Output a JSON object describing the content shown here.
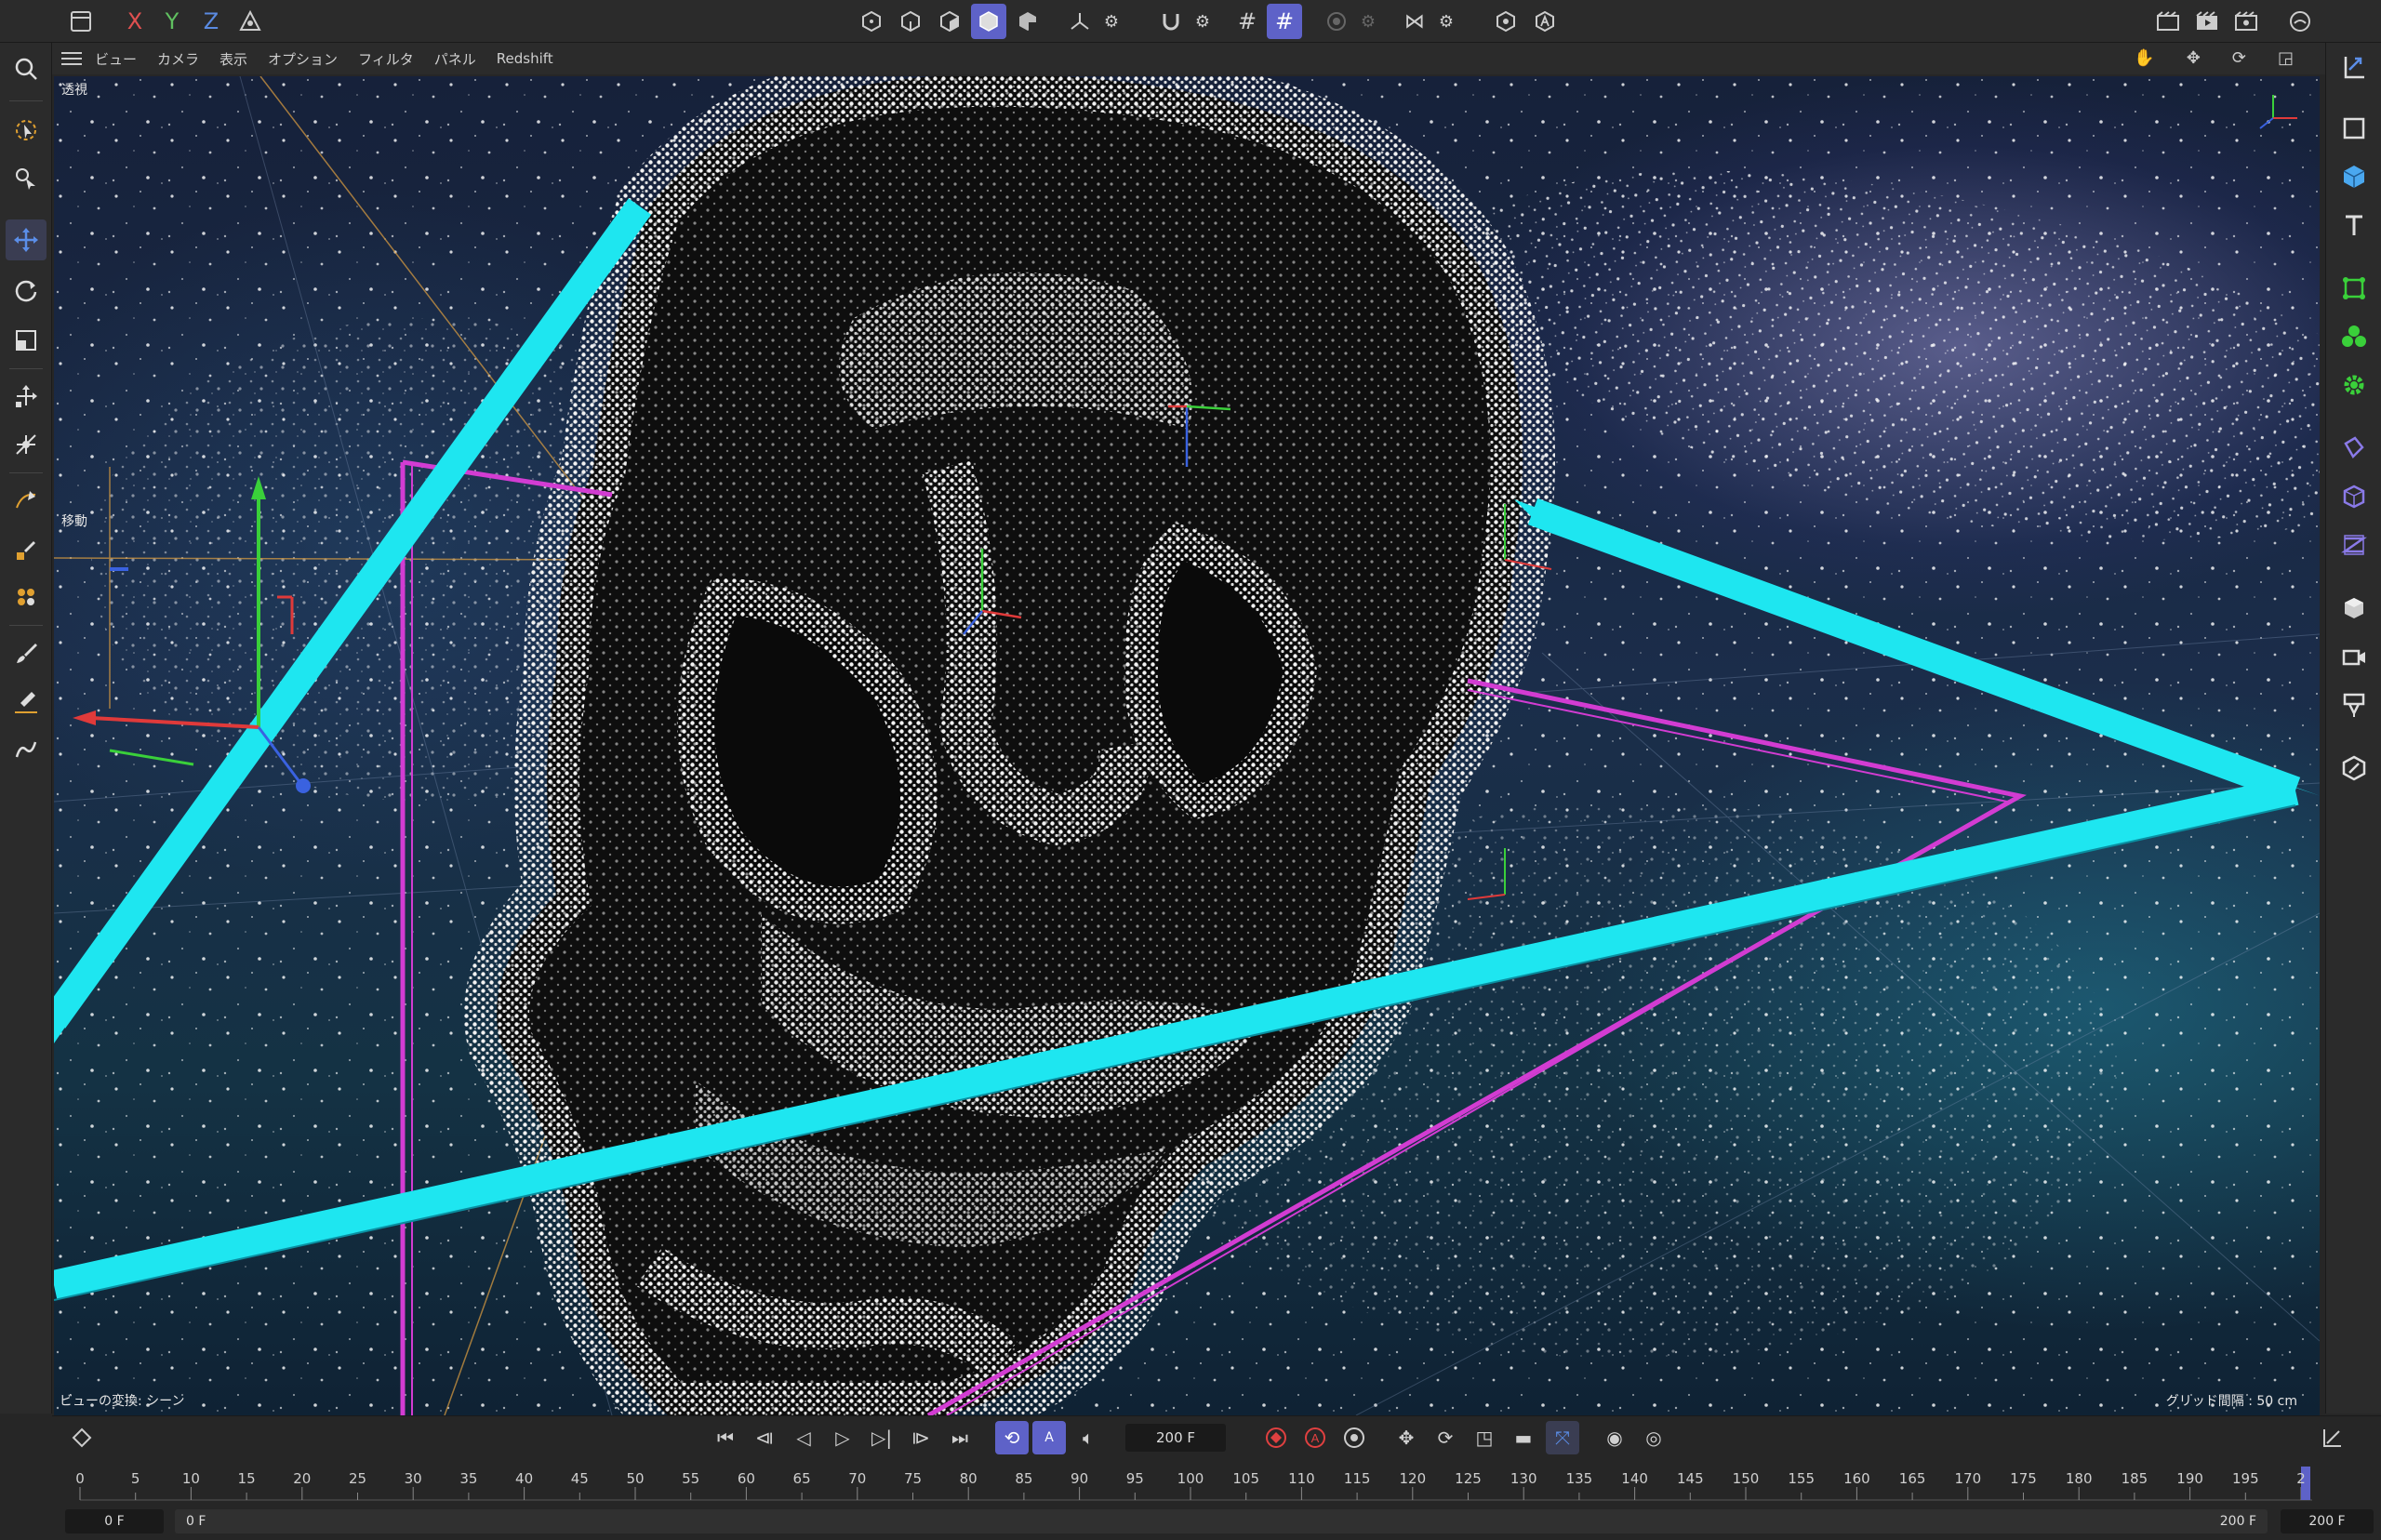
{
  "topbar": {
    "axes": {
      "x": "X",
      "y": "Y",
      "z": "Z"
    }
  },
  "viewport_menu": {
    "items": [
      "ビュー",
      "カメラ",
      "表示",
      "オプション",
      "フィルタ",
      "パネル",
      "Redshift"
    ]
  },
  "viewport": {
    "projection_label": "透視",
    "tool_label": "移動",
    "transform_label": "ビューの変換: シーン",
    "grid_label": "グリッド間隔 : 50 cm"
  },
  "timeline": {
    "current_frame": "200 F",
    "ruler_ticks": [
      "0",
      "5",
      "10",
      "15",
      "20",
      "25",
      "30",
      "35",
      "40",
      "45",
      "50",
      "55",
      "60",
      "65",
      "70",
      "75",
      "80",
      "85",
      "90",
      "95",
      "100",
      "105",
      "110",
      "115",
      "120",
      "125",
      "130",
      "135",
      "140",
      "145",
      "150",
      "155",
      "160",
      "165",
      "170",
      "175",
      "180",
      "185",
      "190",
      "195",
      "2"
    ],
    "range_start": "0 F",
    "range_start_inner": "0 F",
    "range_end_inner": "200 F",
    "range_end": "200 F"
  },
  "colors": {
    "accent": "#5e62c8",
    "cyan_spline": "#1ee6f0",
    "magenta_spline": "#d23cd2"
  }
}
